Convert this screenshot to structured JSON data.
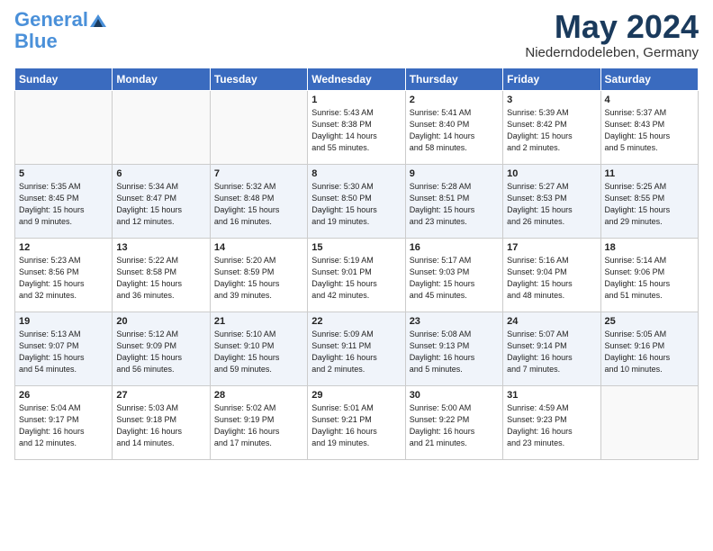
{
  "header": {
    "logo_line1": "General",
    "logo_line2": "Blue",
    "title": "May 2024",
    "subtitle": "Niederndodeleben, Germany"
  },
  "columns": [
    "Sunday",
    "Monday",
    "Tuesday",
    "Wednesday",
    "Thursday",
    "Friday",
    "Saturday"
  ],
  "weeks": [
    [
      {
        "num": "",
        "info": ""
      },
      {
        "num": "",
        "info": ""
      },
      {
        "num": "",
        "info": ""
      },
      {
        "num": "1",
        "info": "Sunrise: 5:43 AM\nSunset: 8:38 PM\nDaylight: 14 hours\nand 55 minutes."
      },
      {
        "num": "2",
        "info": "Sunrise: 5:41 AM\nSunset: 8:40 PM\nDaylight: 14 hours\nand 58 minutes."
      },
      {
        "num": "3",
        "info": "Sunrise: 5:39 AM\nSunset: 8:42 PM\nDaylight: 15 hours\nand 2 minutes."
      },
      {
        "num": "4",
        "info": "Sunrise: 5:37 AM\nSunset: 8:43 PM\nDaylight: 15 hours\nand 5 minutes."
      }
    ],
    [
      {
        "num": "5",
        "info": "Sunrise: 5:35 AM\nSunset: 8:45 PM\nDaylight: 15 hours\nand 9 minutes."
      },
      {
        "num": "6",
        "info": "Sunrise: 5:34 AM\nSunset: 8:47 PM\nDaylight: 15 hours\nand 12 minutes."
      },
      {
        "num": "7",
        "info": "Sunrise: 5:32 AM\nSunset: 8:48 PM\nDaylight: 15 hours\nand 16 minutes."
      },
      {
        "num": "8",
        "info": "Sunrise: 5:30 AM\nSunset: 8:50 PM\nDaylight: 15 hours\nand 19 minutes."
      },
      {
        "num": "9",
        "info": "Sunrise: 5:28 AM\nSunset: 8:51 PM\nDaylight: 15 hours\nand 23 minutes."
      },
      {
        "num": "10",
        "info": "Sunrise: 5:27 AM\nSunset: 8:53 PM\nDaylight: 15 hours\nand 26 minutes."
      },
      {
        "num": "11",
        "info": "Sunrise: 5:25 AM\nSunset: 8:55 PM\nDaylight: 15 hours\nand 29 minutes."
      }
    ],
    [
      {
        "num": "12",
        "info": "Sunrise: 5:23 AM\nSunset: 8:56 PM\nDaylight: 15 hours\nand 32 minutes."
      },
      {
        "num": "13",
        "info": "Sunrise: 5:22 AM\nSunset: 8:58 PM\nDaylight: 15 hours\nand 36 minutes."
      },
      {
        "num": "14",
        "info": "Sunrise: 5:20 AM\nSunset: 8:59 PM\nDaylight: 15 hours\nand 39 minutes."
      },
      {
        "num": "15",
        "info": "Sunrise: 5:19 AM\nSunset: 9:01 PM\nDaylight: 15 hours\nand 42 minutes."
      },
      {
        "num": "16",
        "info": "Sunrise: 5:17 AM\nSunset: 9:03 PM\nDaylight: 15 hours\nand 45 minutes."
      },
      {
        "num": "17",
        "info": "Sunrise: 5:16 AM\nSunset: 9:04 PM\nDaylight: 15 hours\nand 48 minutes."
      },
      {
        "num": "18",
        "info": "Sunrise: 5:14 AM\nSunset: 9:06 PM\nDaylight: 15 hours\nand 51 minutes."
      }
    ],
    [
      {
        "num": "19",
        "info": "Sunrise: 5:13 AM\nSunset: 9:07 PM\nDaylight: 15 hours\nand 54 minutes."
      },
      {
        "num": "20",
        "info": "Sunrise: 5:12 AM\nSunset: 9:09 PM\nDaylight: 15 hours\nand 56 minutes."
      },
      {
        "num": "21",
        "info": "Sunrise: 5:10 AM\nSunset: 9:10 PM\nDaylight: 15 hours\nand 59 minutes."
      },
      {
        "num": "22",
        "info": "Sunrise: 5:09 AM\nSunset: 9:11 PM\nDaylight: 16 hours\nand 2 minutes."
      },
      {
        "num": "23",
        "info": "Sunrise: 5:08 AM\nSunset: 9:13 PM\nDaylight: 16 hours\nand 5 minutes."
      },
      {
        "num": "24",
        "info": "Sunrise: 5:07 AM\nSunset: 9:14 PM\nDaylight: 16 hours\nand 7 minutes."
      },
      {
        "num": "25",
        "info": "Sunrise: 5:05 AM\nSunset: 9:16 PM\nDaylight: 16 hours\nand 10 minutes."
      }
    ],
    [
      {
        "num": "26",
        "info": "Sunrise: 5:04 AM\nSunset: 9:17 PM\nDaylight: 16 hours\nand 12 minutes."
      },
      {
        "num": "27",
        "info": "Sunrise: 5:03 AM\nSunset: 9:18 PM\nDaylight: 16 hours\nand 14 minutes."
      },
      {
        "num": "28",
        "info": "Sunrise: 5:02 AM\nSunset: 9:19 PM\nDaylight: 16 hours\nand 17 minutes."
      },
      {
        "num": "29",
        "info": "Sunrise: 5:01 AM\nSunset: 9:21 PM\nDaylight: 16 hours\nand 19 minutes."
      },
      {
        "num": "30",
        "info": "Sunrise: 5:00 AM\nSunset: 9:22 PM\nDaylight: 16 hours\nand 21 minutes."
      },
      {
        "num": "31",
        "info": "Sunrise: 4:59 AM\nSunset: 9:23 PM\nDaylight: 16 hours\nand 23 minutes."
      },
      {
        "num": "",
        "info": ""
      }
    ]
  ]
}
